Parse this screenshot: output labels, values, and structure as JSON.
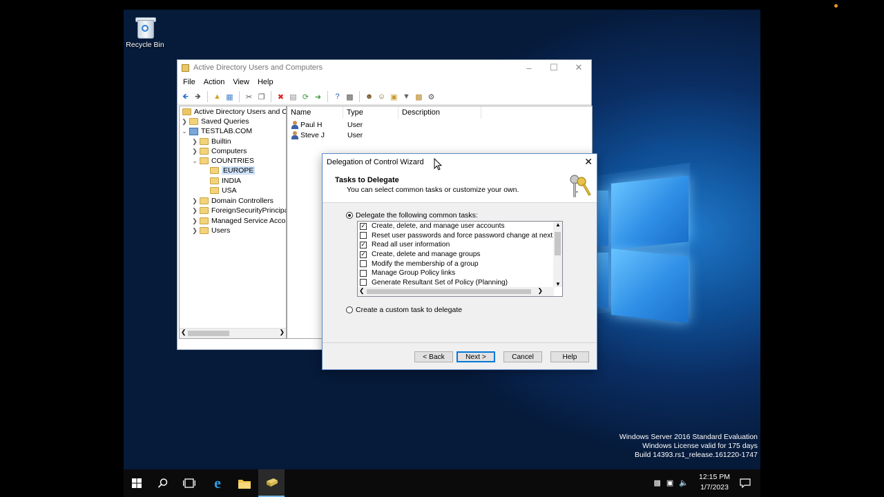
{
  "desktop": {
    "recycle_bin_label": "Recycle Bin",
    "watermark": [
      "Windows Server 2016 Standard Evaluation",
      "Windows License valid for 175 days",
      "Build 14393.rs1_release.161220-1747"
    ]
  },
  "aduc": {
    "title": "Active Directory Users and Computers",
    "menu": [
      "File",
      "Action",
      "View",
      "Help"
    ],
    "tree": {
      "root": "Active Directory Users and Com",
      "saved_queries": "Saved Queries",
      "domain": "TESTLAB.COM",
      "builtin": "Builtin",
      "computers": "Computers",
      "countries": "COUNTRIES",
      "europe": "EUROPE",
      "india": "INDIA",
      "usa": "USA",
      "domain_controllers": "Domain Controllers",
      "foreign": "ForeignSecurityPrincipals",
      "managed": "Managed Service Accour",
      "users": "Users"
    },
    "columns": [
      "Name",
      "Type",
      "Description"
    ],
    "rows": [
      {
        "name": "Paul H",
        "type": "User"
      },
      {
        "name": "Steve J",
        "type": "User"
      }
    ]
  },
  "wizard": {
    "title": "Delegation of Control Wizard",
    "heading": "Tasks to Delegate",
    "subheading": "You can select common tasks or customize your own.",
    "option_common": "Delegate the following common tasks:",
    "option_custom": "Create a custom task to delegate",
    "tasks": [
      {
        "label": "Create, delete, and manage user accounts",
        "checked": true
      },
      {
        "label": "Reset user passwords and force password change at next logon",
        "checked": false
      },
      {
        "label": "Read all user information",
        "checked": true
      },
      {
        "label": "Create, delete and manage groups",
        "checked": true
      },
      {
        "label": "Modify the membership of a group",
        "checked": false
      },
      {
        "label": "Manage Group Policy links",
        "checked": false
      },
      {
        "label": "Generate Resultant Set of Policy (Planning)",
        "checked": false
      }
    ],
    "buttons": {
      "back": "< Back",
      "next": "Next >",
      "cancel": "Cancel",
      "help": "Help"
    }
  },
  "taskbar": {
    "time": "12:15 PM",
    "date": "1/7/2023"
  },
  "colors": {
    "accent": "#0078d7",
    "desktop": "#0a2d62",
    "taskbar": "#0b0b0b"
  }
}
